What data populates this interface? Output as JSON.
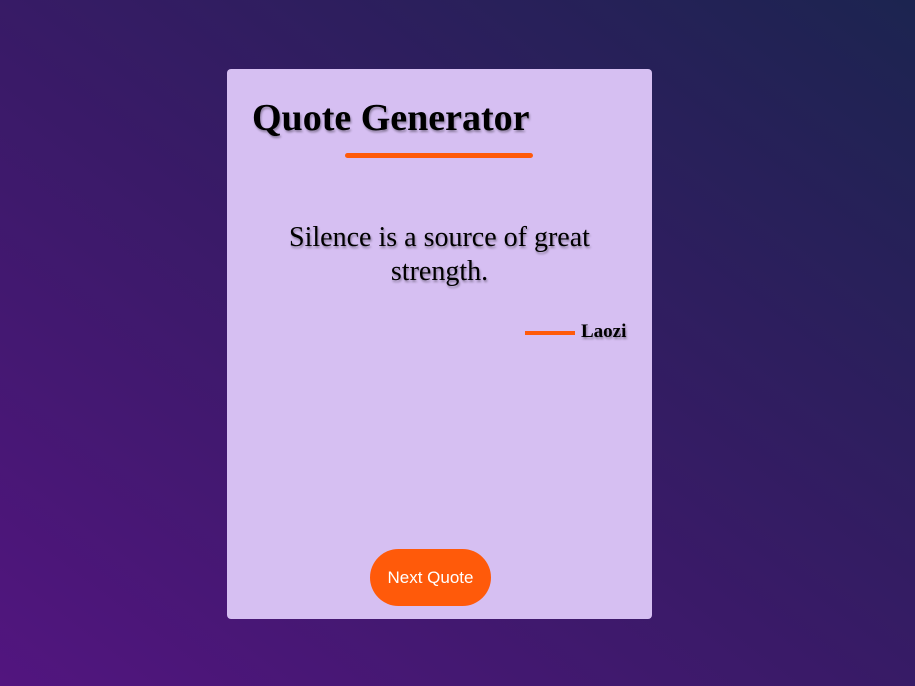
{
  "app": {
    "title": "Quote Generator"
  },
  "quote": {
    "text": "Silence is a source of great strength.",
    "author": "Laozi"
  },
  "actions": {
    "next_label": "Next Quote"
  },
  "colors": {
    "accent": "#ff5a0a",
    "card_background": "#d6bff2",
    "background_start": "#52157f",
    "background_end": "#1c2450",
    "button_text": "#ffffff"
  }
}
